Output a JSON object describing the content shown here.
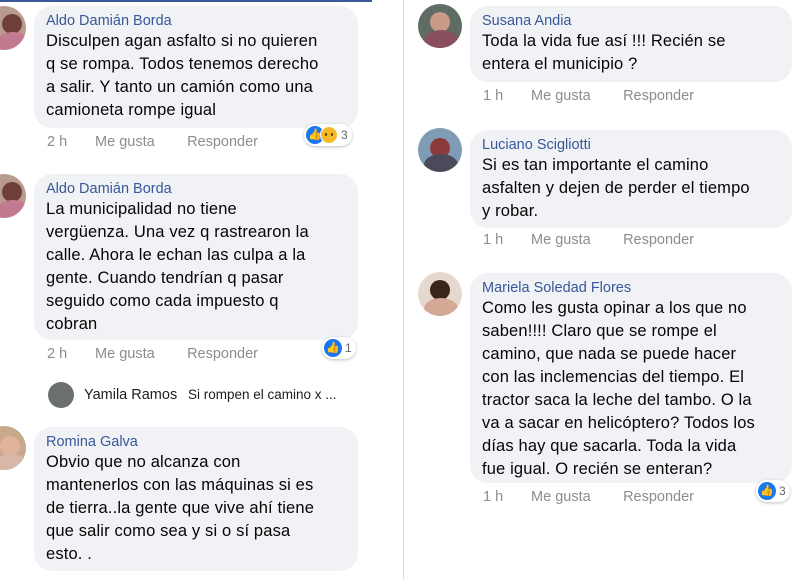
{
  "comments": [
    {
      "author": "Aldo Damián Borda",
      "lines": [
        "Disculpen agan asfalto si no quieren",
        "q se rompa. Todos tenemos derecho",
        "a salir. Y tanto un camión como una",
        "camioneta rompe igual"
      ],
      "time": "2 h",
      "like": "Me gusta",
      "reply": "Responder",
      "reactions_count": "3"
    },
    {
      "author": "Aldo Damián Borda",
      "lines": [
        "La municipalidad no tiene",
        "vergüenza. Una vez q rastrearon la",
        "calle. Ahora le echan las culpa a la",
        "gente. Cuando tendrían q pasar",
        "seguido como cada impuesto q",
        "cobran"
      ],
      "time": "2 h",
      "like": "Me gusta",
      "reply": "Responder",
      "reactions_count": "1"
    },
    {
      "author": "Romina Galva",
      "lines": [
        "Obvio que no alcanza con",
        "mantenerlos con las máquinas si es",
        "de tierra..la gente que vive ahí tiene",
        "que salir como sea y si o sí pasa",
        "esto. ."
      ]
    },
    {
      "author": "Susana Andia",
      "lines": [
        "Toda la vida fue así !!! Recién se",
        "entera el municipio ?"
      ],
      "time": "1 h",
      "like": "Me gusta",
      "reply": "Responder"
    },
    {
      "author": "Luciano Scigliotti",
      "lines": [
        "Si es tan importante el camino",
        "asfalten y dejen de perder el tiempo",
        "y robar."
      ],
      "time": "1 h",
      "like": "Me gusta",
      "reply": "Responder"
    },
    {
      "author": "Mariela Soledad Flores",
      "lines": [
        "Como les gusta opinar a los que no",
        "saben!!!! Claro que se rompe el",
        "camino, que nada se puede hacer",
        "con las inclemencias del tiempo. El",
        "tractor saca la leche del tambo. O la",
        "va a sacar en helicóptero?  Todos los",
        "días hay que sacarla. Toda la vida",
        "fue igual. O recién se enteran?"
      ],
      "time": "1 h",
      "like": "Me gusta",
      "reply": "Responder",
      "reactions_count": "3"
    }
  ],
  "reply_preview": {
    "name": "Yamila Ramos",
    "text": "Si rompen el camino x ..."
  },
  "icons": {
    "like": "thumbs-up-icon",
    "sad": "sad-face-icon"
  },
  "colors": {
    "bubble": "#f0f2f5",
    "author": "#385898",
    "meta": "#8a8d91",
    "like_blue": "#1877f2"
  }
}
